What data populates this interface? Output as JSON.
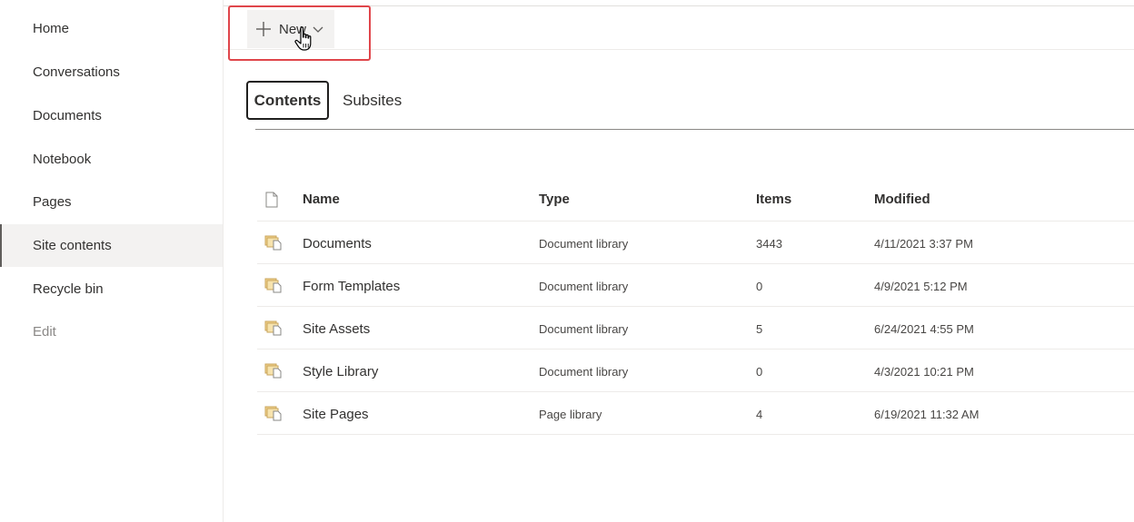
{
  "nav": {
    "items": [
      {
        "label": "Home"
      },
      {
        "label": "Conversations"
      },
      {
        "label": "Documents"
      },
      {
        "label": "Notebook"
      },
      {
        "label": "Pages"
      },
      {
        "label": "Site contents"
      },
      {
        "label": "Recycle bin"
      },
      {
        "label": "Edit"
      }
    ],
    "selected": "Site contents"
  },
  "toolbar": {
    "new_label": "New"
  },
  "tabs": [
    {
      "label": "Contents",
      "active": true
    },
    {
      "label": "Subsites",
      "active": false
    }
  ],
  "table": {
    "columns": [
      "Name",
      "Type",
      "Items",
      "Modified"
    ],
    "rows": [
      {
        "name": "Documents",
        "type": "Document library",
        "items": "3443",
        "modified": "4/11/2021 3:37 PM"
      },
      {
        "name": "Form Templates",
        "type": "Document library",
        "items": "0",
        "modified": "4/9/2021 5:12 PM"
      },
      {
        "name": "Site Assets",
        "type": "Document library",
        "items": "5",
        "modified": "6/24/2021 4:55 PM"
      },
      {
        "name": "Style Library",
        "type": "Document library",
        "items": "0",
        "modified": "4/3/2021 10:21 PM"
      },
      {
        "name": "Site Pages",
        "type": "Page library",
        "items": "4",
        "modified": "6/19/2021 11:32 AM"
      }
    ]
  },
  "colors": {
    "highlight": "#e0464b",
    "library_icon": "#c8a45c",
    "selected_nav_bg": "#f3f2f1"
  }
}
